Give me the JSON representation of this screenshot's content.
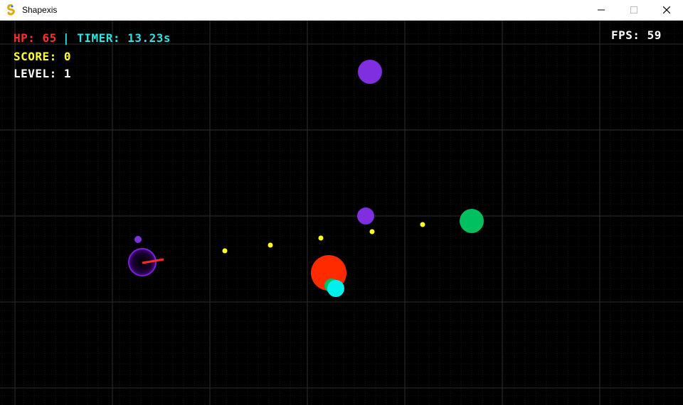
{
  "window": {
    "title": "Shapexis",
    "app_icon": "pygame-snake-icon",
    "controls": {
      "minimize_icon": "minimize-icon",
      "maximize_icon": "maximize-icon",
      "close_icon": "close-icon"
    }
  },
  "hud": {
    "hp": "HP: 65",
    "timer": "| TIMER: 13.23s",
    "score": "SCORE: 0",
    "level": "LEVEL: 1",
    "fps": "FPS: 59"
  },
  "colors": {
    "background": "#000000",
    "grid_major": "#2e2e2e",
    "grid_minor": "#141414",
    "hp": "#ff3030",
    "timer": "#33e0e0",
    "score": "#ffff33",
    "level": "#ffffff",
    "fps": "#ffffff",
    "player_fill": "#140022",
    "player_ring": "#7a1fd6",
    "player_gun": "#ff2a2a",
    "bullet": "#ffff1a",
    "enemy_purple": "#7f2fe0",
    "enemy_green": "#00c060",
    "enemy_red": "#ff2a00",
    "enemy_cyan": "#00f0f0"
  },
  "entities": {
    "player": {
      "type": "player",
      "label": "player"
    },
    "bullets": [
      {
        "name": "bullet-1"
      },
      {
        "name": "bullet-2"
      },
      {
        "name": "bullet-3"
      },
      {
        "name": "bullet-4"
      },
      {
        "name": "bullet-5"
      }
    ],
    "enemies": [
      {
        "name": "enemy-purple-large",
        "color": "enemy_purple"
      },
      {
        "name": "enemy-purple-medium",
        "color": "enemy_purple"
      },
      {
        "name": "enemy-purple-small",
        "color": "enemy_purple"
      },
      {
        "name": "enemy-green",
        "color": "enemy_green"
      },
      {
        "name": "enemy-red",
        "color": "enemy_red"
      },
      {
        "name": "enemy-green-small",
        "color": "enemy_green"
      },
      {
        "name": "enemy-cyan",
        "color": "enemy_cyan"
      }
    ]
  }
}
